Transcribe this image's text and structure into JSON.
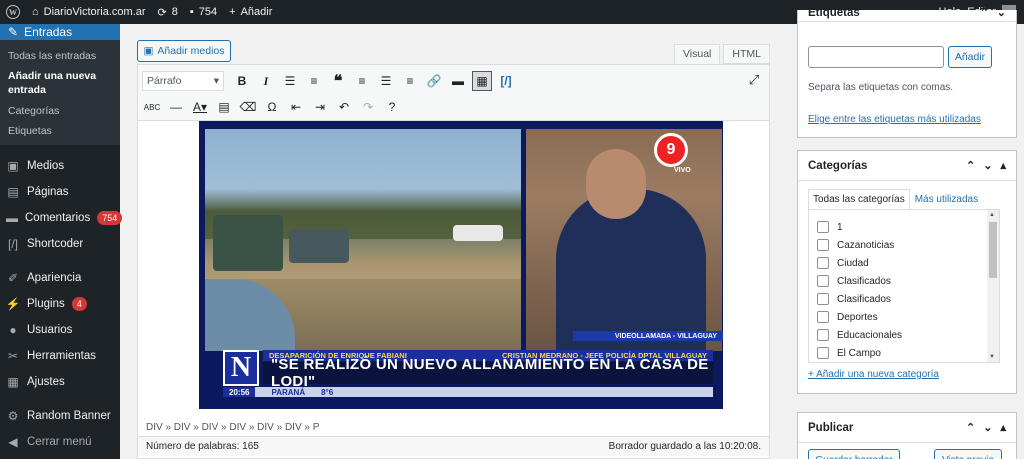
{
  "adminbar": {
    "site_name": "DiarioVictoria.com.ar",
    "updates_count": "8",
    "comments_count": "754",
    "new_label": "Añadir",
    "greeting": "Hola, Editor"
  },
  "sidebar": {
    "current_menu": "Entradas",
    "submenu": [
      "Todas las entradas",
      "Añadir una nueva entrada",
      "Categorías",
      "Etiquetas"
    ],
    "items": [
      {
        "label": "Medios",
        "icon": "media-icon"
      },
      {
        "label": "Páginas",
        "icon": "pages-icon"
      },
      {
        "label": "Comentarios",
        "icon": "comments-icon",
        "badge": "754"
      },
      {
        "label": "Shortcoder",
        "icon": "shortcode-icon"
      },
      {
        "label": "Apariencia",
        "icon": "brush-icon"
      },
      {
        "label": "Plugins",
        "icon": "plugin-icon",
        "badge": "4"
      },
      {
        "label": "Usuarios",
        "icon": "users-icon"
      },
      {
        "label": "Herramientas",
        "icon": "wrench-icon"
      },
      {
        "label": "Ajustes",
        "icon": "settings-icon"
      },
      {
        "label": "Random Banner",
        "icon": "gear-icon"
      },
      {
        "label": "Cerrar menú",
        "icon": "collapse-icon"
      }
    ]
  },
  "editor": {
    "add_media": "Añadir medios",
    "tab_visual": "Visual",
    "tab_html": "HTML",
    "format_select": "Párrafo",
    "path": "DIV » DIV » DIV » DIV » DIV » DIV » P",
    "word_count": "Número de palabras: 165",
    "draft_saved": "Borrador guardado a las 10:20:08."
  },
  "video": {
    "channel": "9",
    "live": "VIVO",
    "videollamada": "VIDEOLLAMADA - VILLAGUAY",
    "topic": "DESAPARICIÓN DE ENRIQUE FABIANI",
    "speaker": "CRISTIAN MEDRANO - JEFE POLICÍA DPTAL VILLAGUAY",
    "headline": "\"SE REALIZÓ UN NUEVO ALLANAMIENTO EN LA CASA DE LODI\"",
    "time": "20:56",
    "city": "PARANÁ",
    "temp": "8°6"
  },
  "tags_box": {
    "title": "Etiquetas",
    "add_button": "Añadir",
    "hint": "Separa las etiquetas con comas.",
    "link": "Elige entre las etiquetas más utilizadas"
  },
  "categories_box": {
    "title": "Categorías",
    "tab_all": "Todas las categorías",
    "tab_popular": "Más utilizadas",
    "items": [
      "1",
      "Cazanoticias",
      "Ciudad",
      "Clasificados",
      "Clasificados",
      "Deportes",
      "Educacionales",
      "El Campo"
    ],
    "add_link": "+ Añadir una nueva categoría"
  },
  "publish_box": {
    "title": "Publicar",
    "save_draft": "Guardar borrador",
    "preview": "Vista previa"
  }
}
